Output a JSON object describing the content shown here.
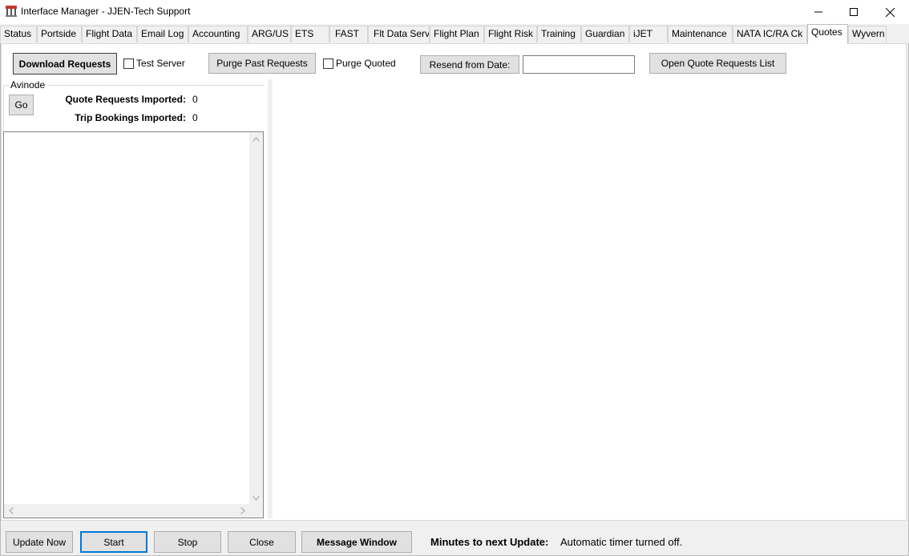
{
  "window": {
    "title": "Interface Manager - JJEN-Tech Support",
    "icon": "app-logo-icon"
  },
  "tabs": [
    {
      "label": "Status"
    },
    {
      "label": "Portside"
    },
    {
      "label": "Flight Data"
    },
    {
      "label": "Email Log"
    },
    {
      "label": "Accounting"
    },
    {
      "label": "ARG/US"
    },
    {
      "label": "ETS"
    },
    {
      "label": "FAST"
    },
    {
      "label": "Flt Data Serv"
    },
    {
      "label": "Flight Plan"
    },
    {
      "label": "Flight Risk"
    },
    {
      "label": "Training"
    },
    {
      "label": "Guardian"
    },
    {
      "label": "iJET"
    },
    {
      "label": "Maintenance"
    },
    {
      "label": "NATA IC/RA Ck"
    },
    {
      "label": "Quotes",
      "active": true
    },
    {
      "label": "Wyvern"
    }
  ],
  "toolbar": {
    "download_requests": "Download Requests",
    "test_server": "Test Server",
    "purge_past_requests": "Purge Past Requests",
    "purge_quoted": "Purge Quoted",
    "resend_from_date": "Resend from Date:",
    "resend_date_value": "",
    "open_quote_requests_list": "Open Quote Requests List"
  },
  "avinode": {
    "group_title": "Avinode",
    "go_button": "Go",
    "quote_requests_label": "Quote Requests Imported:",
    "quote_requests_value": "0",
    "trip_bookings_label": "Trip Bookings Imported:",
    "trip_bookings_value": "0"
  },
  "bottom": {
    "update_now": "Update Now",
    "start": "Start",
    "stop": "Stop",
    "close": "Close",
    "message_window": "Message Window",
    "minutes_label": "Minutes to next Update:",
    "timer_status": "Automatic timer turned off."
  }
}
